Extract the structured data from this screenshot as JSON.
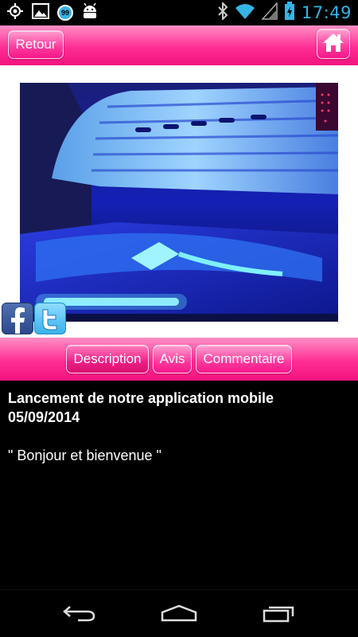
{
  "status_bar": {
    "notification_badge": "99",
    "time": "17:49",
    "icons": [
      "gps-icon",
      "image-icon",
      "notification-badge",
      "android-icon",
      "bluetooth-icon",
      "wifi-icon",
      "signal-icon",
      "battery-icon"
    ]
  },
  "header": {
    "back_label": "Retour",
    "home_icon": "home-icon"
  },
  "social": {
    "facebook_icon": "facebook-icon",
    "twitter_icon": "twitter-icon"
  },
  "tabs": [
    {
      "label": "Description",
      "active": true
    },
    {
      "label": "Avis",
      "active": false
    },
    {
      "label": "Commentaire",
      "active": false
    }
  ],
  "content": {
    "title": "Lancement de notre application mobile",
    "date": "05/09/2014",
    "body": "\" Bonjour et bienvenue \""
  },
  "navigation": {
    "back_icon": "nav-back-icon",
    "home_icon": "nav-home-icon",
    "recent_icon": "nav-recent-apps-icon"
  },
  "colors": {
    "accent_pink": "#ff2e94",
    "status_time": "#33b5e5"
  }
}
